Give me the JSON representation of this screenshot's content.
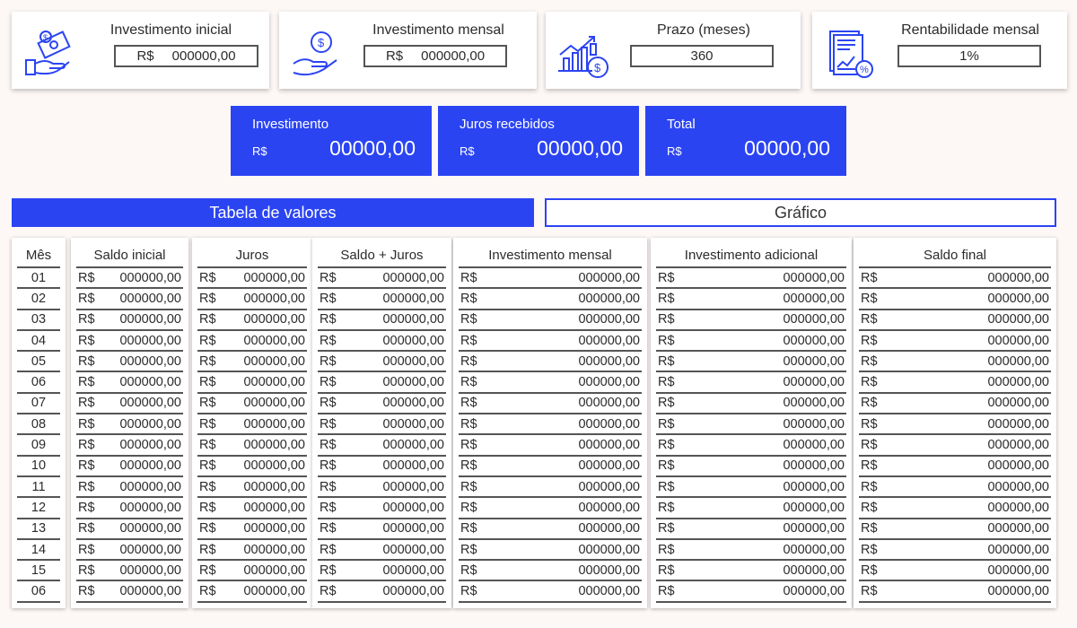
{
  "inputs": [
    {
      "title": "Investimento inicial",
      "currency": "R$",
      "value": "000000,00",
      "icon": "cash-hand-icon"
    },
    {
      "title": "Investimento mensal",
      "currency": "R$",
      "value": "000000,00",
      "icon": "coin-hand-icon"
    },
    {
      "title": "Prazo (meses)",
      "currency": "",
      "value": "360",
      "icon": "growth-chart-icon"
    },
    {
      "title": "Rentabilidade mensal",
      "currency": "",
      "value": "1%",
      "icon": "report-percent-icon"
    }
  ],
  "summary": [
    {
      "title": "Investimento",
      "currency": "R$",
      "value": "00000,00"
    },
    {
      "title": "Juros recebidos",
      "currency": "R$",
      "value": "00000,00"
    },
    {
      "title": "Total",
      "currency": "R$",
      "value": "00000,00"
    }
  ],
  "tabs": {
    "table": "Tabela de valores",
    "chart": "Gráfico"
  },
  "table": {
    "headers": [
      "Mês",
      "Saldo inicial",
      "Juros",
      "Saldo + Juros",
      "Investimento mensal",
      "Investimento adicional",
      "Saldo final"
    ],
    "months": [
      "01",
      "02",
      "03",
      "04",
      "05",
      "06",
      "07",
      "08",
      "09",
      "10",
      "11",
      "12",
      "13",
      "14",
      "15",
      "06"
    ],
    "currency": "R$",
    "cell_value": "000000,00"
  },
  "colors": {
    "accent": "#2b44f2",
    "background": "#fdf8f6"
  }
}
